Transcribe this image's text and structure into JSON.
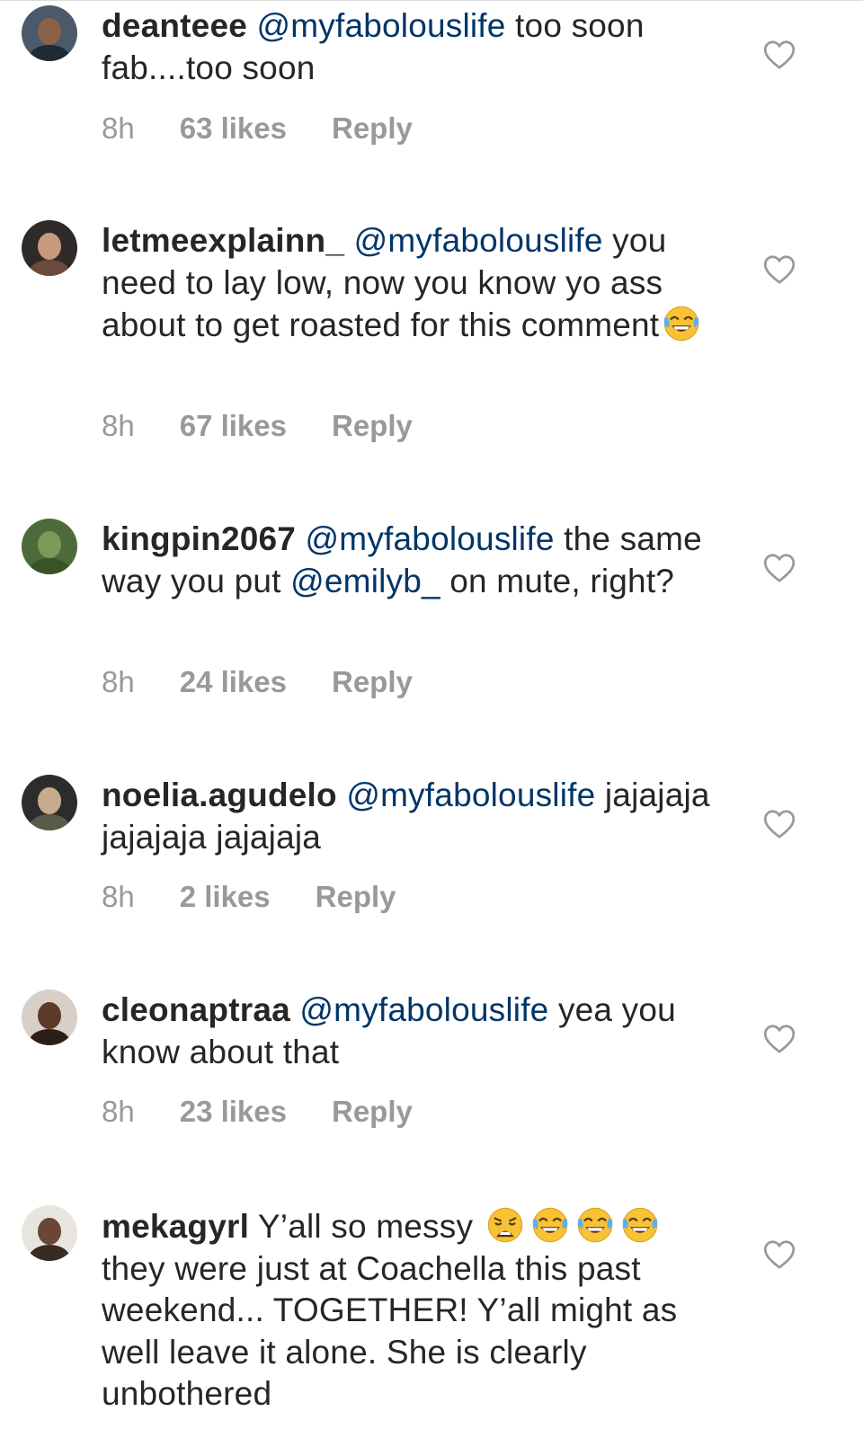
{
  "comments": [
    {
      "username": "deanteee",
      "segments": [
        {
          "type": "mention",
          "text": "@myfabolouslife"
        },
        {
          "type": "text",
          "text": " too soon fab....too soon"
        }
      ],
      "time": "8h",
      "likes": "63 likes",
      "reply": "Reply",
      "avatar_colors": {
        "bg": "#4a5a6a",
        "face": "#8a6248",
        "shirt": "#1e2a36"
      }
    },
    {
      "username": "letmeexplainn_",
      "segments": [
        {
          "type": "mention",
          "text": "@myfabolouslife"
        },
        {
          "type": "text",
          "text": " you need to lay low, now you know yo ass about to get roasted for this comment"
        },
        {
          "type": "emoji",
          "name": "face-with-tears-of-joy-icon"
        }
      ],
      "time": "8h",
      "likes": "67 likes",
      "reply": "Reply",
      "avatar_colors": {
        "bg": "#2f2a2a",
        "face": "#c89a7c",
        "shirt": "#6b4a3c"
      }
    },
    {
      "username": "kingpin2067",
      "segments": [
        {
          "type": "mention",
          "text": "@myfabolouslife"
        },
        {
          "type": "text",
          "text": " the same way you put "
        },
        {
          "type": "mention",
          "text": "@emilyb_"
        },
        {
          "type": "text",
          "text": " on mute, right?"
        }
      ],
      "time": "8h",
      "likes": "24 likes",
      "reply": "Reply",
      "avatar_colors": {
        "bg": "#4d6b3a",
        "face": "#7a9a5a",
        "shirt": "#3a5228"
      }
    },
    {
      "username": "noelia.agudelo",
      "segments": [
        {
          "type": "mention",
          "text": "@myfabolouslife"
        },
        {
          "type": "text",
          "text": " jajajaja jajajaja jajajaja"
        }
      ],
      "time": "8h",
      "likes": "2 likes",
      "reply": "Reply",
      "avatar_colors": {
        "bg": "#2c2c2c",
        "face": "#c8aa8c",
        "shirt": "#5a5a4a"
      }
    },
    {
      "username": "cleonaptraa",
      "segments": [
        {
          "type": "mention",
          "text": "@myfabolouslife"
        },
        {
          "type": "text",
          "text": " yea you know about that"
        }
      ],
      "time": "8h",
      "likes": "23 likes",
      "reply": "Reply",
      "avatar_colors": {
        "bg": "#d8d0c8",
        "face": "#5a3a28",
        "shirt": "#2a1e18"
      }
    },
    {
      "username": "mekagyrl",
      "segments": [
        {
          "type": "text",
          "text": " Y’all so messy "
        },
        {
          "type": "emoji",
          "name": "weary-face-icon"
        },
        {
          "type": "emoji",
          "name": "face-with-tears-of-joy-icon"
        },
        {
          "type": "emoji",
          "name": "face-with-tears-of-joy-icon"
        },
        {
          "type": "emoji",
          "name": "face-with-tears-of-joy-icon"
        },
        {
          "type": "text",
          "text": " they were just at Coachella this past weekend... TOGETHER! Y’all might as well leave it alone. She is clearly unbothered"
        }
      ],
      "avatar_colors": {
        "bg": "#e8e4e0",
        "face": "#6a4634",
        "shirt": "#3a2a24"
      }
    }
  ],
  "colors": {
    "username": "#262626",
    "mention": "#003569",
    "meta": "#999999",
    "heart": "#999999"
  }
}
